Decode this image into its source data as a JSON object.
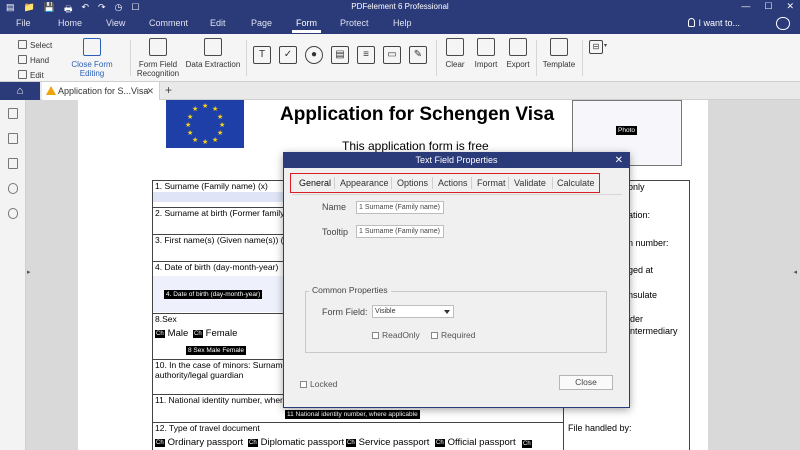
{
  "app": {
    "title": "PDFelement 6 Professional",
    "quick_access": [
      "▤",
      "📁",
      "💾",
      "🖶",
      "↶",
      "↷",
      "◷",
      "☐"
    ],
    "window_controls": [
      "—",
      "☐",
      "✕"
    ]
  },
  "menu": {
    "tabs": [
      "File",
      "Home",
      "View",
      "Comment",
      "Edit",
      "Page",
      "Form",
      "Protect",
      "Help"
    ],
    "active": "Form",
    "search": "I want to..."
  },
  "ribbon": {
    "select": "Select",
    "hand": "Hand",
    "edit": "Edit",
    "close_form_editing": "Close Form Editing",
    "form_field_recognition_1": "Form Field",
    "form_field_recognition_2": "Recognition",
    "data_extraction": "Data Extraction",
    "clear": "Clear",
    "import": "Import",
    "export": "Export",
    "template": "Template"
  },
  "tabstrip": {
    "doc_tab": "Application for S...Visa",
    "add": "+"
  },
  "document": {
    "title": "Application for Schengen Visa",
    "subtitle": "This application form is free",
    "photo": "Photo",
    "rows": [
      "1. Surname (Family name) (x)",
      "2. Surname at birth (Former family na",
      "3. First name(s) (Given name(s)) (x)",
      "4. Date of birth (day-month-year)",
      "8.Sex",
      "10. In the case of minors: Surname, f",
      "authority/legal guardian",
      "11. National identity number, where a",
      "12. Type of travel document"
    ],
    "tag_dob": "4. Date of birth (day-month-year)",
    "tag_sex": "8 Sex Male Female",
    "tag_nid": "11 National identity number, where applicable",
    "cb": "Ch",
    "male": "Male",
    "female": "Female",
    "passports": [
      "Ordinary passport",
      "Diplomatic passport",
      "Service passport",
      "Official passport"
    ],
    "right_col": [
      "only",
      "ation:",
      "n number:",
      "ged at",
      "nsulate",
      "ider",
      "intermediary",
      "File handled by:"
    ]
  },
  "dialog": {
    "title": "Text Field Properties",
    "close": "✕",
    "tabs": [
      "General",
      "Appearance",
      "Options",
      "Actions",
      "Format",
      "Validate",
      "Calculate"
    ],
    "name_label": "Name",
    "name_value": "1  Surname (Family name)",
    "tooltip_label": "Tooltip",
    "tooltip_value": "1  Surname (Family name)",
    "common_properties": "Common Properties",
    "form_field_label": "Form Field:",
    "form_field_value": "Visible",
    "readonly": "ReadOnly",
    "required": "Required",
    "locked": "Locked",
    "close_button": "Close"
  }
}
